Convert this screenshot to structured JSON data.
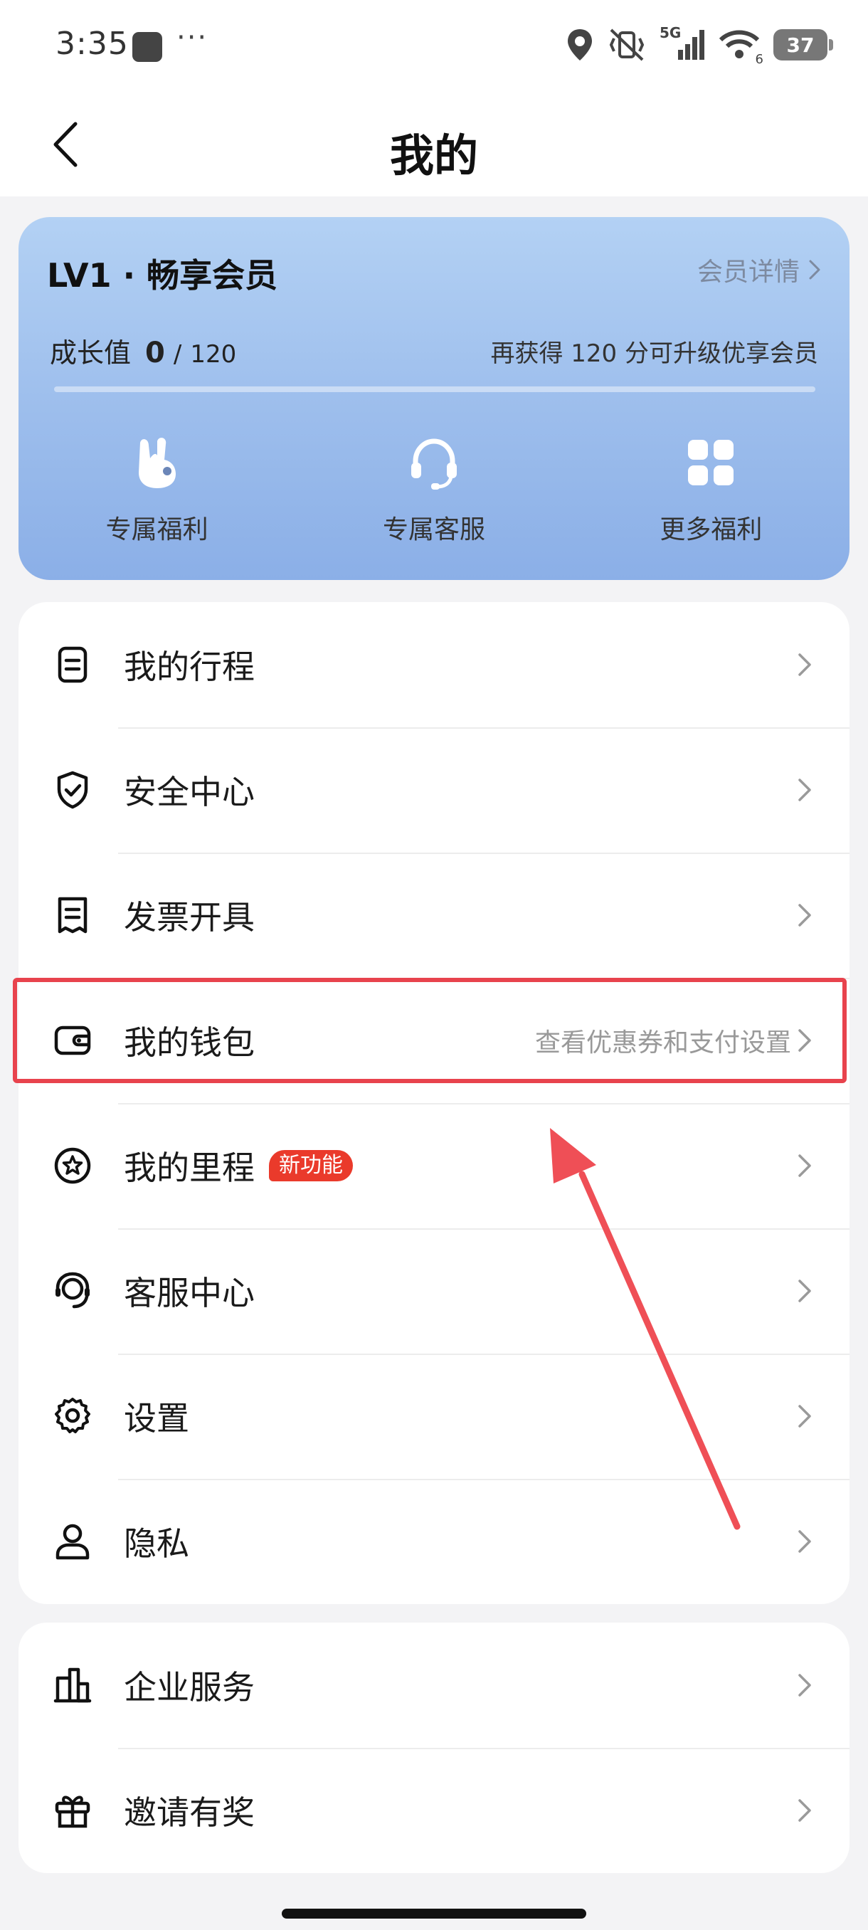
{
  "status_bar": {
    "time": "3:35",
    "more_dots": "···",
    "network": "5G",
    "wifi_badge": "6",
    "battery": "37"
  },
  "header": {
    "title": "我的",
    "back_icon": "chevron-left-icon"
  },
  "member_card": {
    "level_title": "LV1 · 畅享会员",
    "detail_link": "会员详情",
    "growth_label": "成长值",
    "growth_current": "0",
    "growth_separator": "/",
    "growth_total": "120",
    "upgrade_tip": "再获得 120 分可升级优享会员",
    "progress_fraction": 0,
    "benefits": [
      {
        "label": "专属福利",
        "icon": "rabbit-gift-icon"
      },
      {
        "label": "专属客服",
        "icon": "headset-icon"
      },
      {
        "label": "更多福利",
        "icon": "grid-icon"
      }
    ]
  },
  "menu_main": [
    {
      "label": "我的行程",
      "icon": "itinerary-icon"
    },
    {
      "label": "安全中心",
      "icon": "shield-icon"
    },
    {
      "label": "发票开具",
      "icon": "receipt-icon"
    },
    {
      "label": "我的钱包",
      "icon": "wallet-icon",
      "sub": "查看优惠券和支付设置"
    },
    {
      "label": "我的里程",
      "icon": "star-badge-icon",
      "badge": "新功能"
    },
    {
      "label": "客服中心",
      "icon": "customer-service-icon"
    },
    {
      "label": "设置",
      "icon": "gear-icon"
    },
    {
      "label": "隐私",
      "icon": "person-icon"
    }
  ],
  "menu_secondary": [
    {
      "label": "企业服务",
      "icon": "building-icon"
    },
    {
      "label": "邀请有奖",
      "icon": "gift-icon"
    }
  ],
  "colors": {
    "highlight": "#e8434d",
    "badge": "#ea3a2b",
    "card_gradient_top": "#b3d1f4",
    "card_gradient_bottom": "#8bafe7"
  }
}
